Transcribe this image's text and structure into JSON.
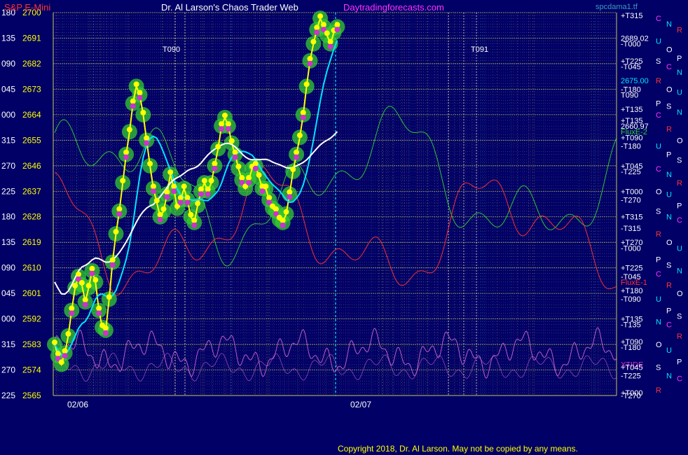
{
  "header": {
    "symbol": "S&P E-Mini",
    "title": "Dr. Al Larson's Chaos Trader Web",
    "site": "Daytradingforecasts.com",
    "filename": "spcdama1.tf"
  },
  "footer": {
    "copyright": "Copyright 2018, Dr. Al Larson. May not be copied by any means."
  },
  "colors": {
    "background": "#000066",
    "price_label": "#ffff00",
    "angle_label": "#ffffff",
    "symbol": "#ff3333",
    "title": "#ffffff",
    "site": "#ff33ff",
    "grid_yellow": "#c8c860",
    "grid_purple": "#8a3aa0",
    "grid_cyan": "#3a9ac0",
    "price_line": "#ffff00",
    "ma_white": "#ffffff",
    "ma_cyan": "#00e5ff",
    "halo": "#33cc33",
    "dot_yellow": "#ffff00",
    "dot_magenta": "#cc33cc",
    "flux_red": "#ff3333",
    "flux_green": "#33cc33",
    "flux_magenta": "#cc66cc"
  },
  "chart_data": {
    "type": "line",
    "title": "S&P E-Mini",
    "y_axis": {
      "range": [
        2565,
        2700
      ],
      "ticks": [
        2700,
        2691,
        2682,
        2673,
        2664,
        2655,
        2646,
        2637,
        2628,
        2619,
        2610,
        2601,
        2592,
        2583,
        2574,
        2565
      ],
      "angle_labels": [
        "180",
        "135",
        "090",
        "045",
        "000",
        "315",
        "270",
        "225",
        "180",
        "135",
        "090",
        "045",
        "000",
        "315",
        "270",
        "225"
      ]
    },
    "x_axis": {
      "date_labels": [
        "02/06",
        "02/07"
      ]
    },
    "session_labels": [
      "T090",
      "T091"
    ],
    "price_series": {
      "name": "S&P E-Mini",
      "points": [
        [
          0,
          2583
        ],
        [
          2,
          2579
        ],
        [
          4,
          2576
        ],
        [
          6,
          2580
        ],
        [
          8,
          2586
        ],
        [
          10,
          2595
        ],
        [
          12,
          2603
        ],
        [
          14,
          2607
        ],
        [
          16,
          2604
        ],
        [
          18,
          2598
        ],
        [
          20,
          2603
        ],
        [
          22,
          2609
        ],
        [
          24,
          2605
        ],
        [
          26,
          2595
        ],
        [
          28,
          2589
        ],
        [
          30,
          2588
        ],
        [
          32,
          2599
        ],
        [
          34,
          2612
        ],
        [
          36,
          2622
        ],
        [
          38,
          2630
        ],
        [
          40,
          2640
        ],
        [
          42,
          2650
        ],
        [
          44,
          2658
        ],
        [
          46,
          2668
        ],
        [
          48,
          2674
        ],
        [
          50,
          2671
        ],
        [
          52,
          2664
        ],
        [
          54,
          2655
        ],
        [
          56,
          2646
        ],
        [
          58,
          2638
        ],
        [
          60,
          2633
        ],
        [
          62,
          2628
        ],
        [
          64,
          2630
        ],
        [
          66,
          2636
        ],
        [
          68,
          2643
        ],
        [
          70,
          2638
        ],
        [
          72,
          2631
        ],
        [
          74,
          2634
        ],
        [
          76,
          2638
        ],
        [
          78,
          2634
        ],
        [
          80,
          2628
        ],
        [
          82,
          2626
        ],
        [
          84,
          2632
        ],
        [
          86,
          2637
        ],
        [
          88,
          2640
        ],
        [
          90,
          2637
        ],
        [
          92,
          2640
        ],
        [
          94,
          2646
        ],
        [
          96,
          2652
        ],
        [
          98,
          2660
        ],
        [
          100,
          2663
        ],
        [
          102,
          2660
        ],
        [
          104,
          2654
        ],
        [
          106,
          2650
        ],
        [
          108,
          2645
        ],
        [
          110,
          2641
        ],
        [
          112,
          2638
        ],
        [
          114,
          2641
        ],
        [
          116,
          2645
        ],
        [
          118,
          2646
        ],
        [
          120,
          2642
        ],
        [
          122,
          2638
        ],
        [
          124,
          2638
        ],
        [
          126,
          2634
        ],
        [
          128,
          2631
        ],
        [
          130,
          2630
        ],
        [
          132,
          2627
        ],
        [
          134,
          2626
        ],
        [
          136,
          2629
        ],
        [
          138,
          2636
        ],
        [
          140,
          2644
        ],
        [
          142,
          2650
        ],
        [
          144,
          2656
        ],
        [
          146,
          2664
        ],
        [
          148,
          2674
        ],
        [
          150,
          2683
        ],
        [
          152,
          2689
        ],
        [
          154,
          2694
        ],
        [
          156,
          2698
        ],
        [
          158,
          2695
        ],
        [
          160,
          2692
        ],
        [
          162,
          2689
        ],
        [
          164,
          2693
        ],
        [
          166,
          2695
        ]
      ]
    },
    "flux_lines": [
      {
        "name": "flux-1",
        "label": "Flux E-1"
      },
      {
        "name": "flux-2",
        "label": "Flux E-2"
      },
      {
        "name": "xtide",
        "label": "XTIDE"
      }
    ],
    "right_labels": [
      {
        "price": 2699,
        "text": "+T315",
        "color": "#ffffff"
      },
      {
        "price": 2691,
        "text": "2689.02",
        "color": "#ffffff"
      },
      {
        "price": 2689,
        "text": "-T000",
        "color": "#ffffff"
      },
      {
        "price": 2683,
        "text": "+T225",
        "color": "#ffffff"
      },
      {
        "price": 2681,
        "text": "-T045",
        "color": "#ffffff"
      },
      {
        "price": 2676,
        "text": "2675.00",
        "color": "#00e5ff"
      },
      {
        "price": 2673,
        "text": "-T180",
        "color": "#ffffff"
      },
      {
        "price": 2671,
        "text": "T090",
        "color": "#ffffff"
      },
      {
        "price": 2666,
        "text": "+T135",
        "color": "#ffffff"
      },
      {
        "price": 2662,
        "text": "+T135",
        "color": "#ffffff"
      },
      {
        "price": 2660,
        "text": "2660.97",
        "color": "#ffffff"
      },
      {
        "price": 2658,
        "text": "FluxE-2",
        "color": "#33cc33"
      },
      {
        "price": 2656,
        "text": "+T090",
        "color": "#ffffff"
      },
      {
        "price": 2653,
        "text": "-T180",
        "color": "#ffffff"
      },
      {
        "price": 2646,
        "text": "+T045",
        "color": "#ffffff"
      },
      {
        "price": 2644,
        "text": "-T225",
        "color": "#ffffff"
      },
      {
        "price": 2637,
        "text": "+T000",
        "color": "#ffffff"
      },
      {
        "price": 2634,
        "text": "-T270",
        "color": "#ffffff"
      },
      {
        "price": 2628,
        "text": "+T315",
        "color": "#ffffff"
      },
      {
        "price": 2624,
        "text": "-T315",
        "color": "#ffffff"
      },
      {
        "price": 2619,
        "text": "+T270",
        "color": "#ffffff"
      },
      {
        "price": 2617,
        "text": "-T000",
        "color": "#ffffff"
      },
      {
        "price": 2610,
        "text": "+T225",
        "color": "#ffffff"
      },
      {
        "price": 2607,
        "text": "-T045",
        "color": "#ffffff"
      },
      {
        "price": 2605,
        "text": "FluxE-1",
        "color": "#ff3333"
      },
      {
        "price": 2602,
        "text": "+T180",
        "color": "#ffffff"
      },
      {
        "price": 2599,
        "text": "-T090",
        "color": "#ffffff"
      },
      {
        "price": 2592,
        "text": "+T135",
        "color": "#ffffff"
      },
      {
        "price": 2590,
        "text": "-T135",
        "color": "#ffffff"
      },
      {
        "price": 2584,
        "text": "+T090",
        "color": "#ffffff"
      },
      {
        "price": 2582,
        "text": "-T180",
        "color": "#ffffff"
      },
      {
        "price": 2576,
        "text": "XTIDE",
        "color": "#cc33cc"
      },
      {
        "price": 2575,
        "text": "+T045",
        "color": "#ffffff"
      },
      {
        "price": 2572,
        "text": "-T225",
        "color": "#ffffff"
      },
      {
        "price": 2566,
        "text": "+T000",
        "color": "#ffffff"
      },
      {
        "price": 2565,
        "text": "-T270",
        "color": "#ffffff"
      }
    ],
    "planet_column": [
      {
        "price": 2698,
        "text": "C",
        "color": "#ff33ff"
      },
      {
        "price": 2696,
        "text": "N",
        "color": "#00e5ff"
      },
      {
        "price": 2694,
        "text": "R",
        "color": "#ff3333"
      },
      {
        "price": 2690,
        "text": "U",
        "color": "#00e5ff"
      },
      {
        "price": 2687,
        "text": "O",
        "color": "#ffffff"
      },
      {
        "price": 2684,
        "text": "P",
        "color": "#ffffff"
      },
      {
        "price": 2683,
        "text": "S",
        "color": "#ffffff"
      },
      {
        "price": 2681,
        "text": "C",
        "color": "#ff33ff"
      },
      {
        "price": 2679,
        "text": "N",
        "color": "#00e5ff"
      },
      {
        "price": 2676,
        "text": "R",
        "color": "#ff3333"
      },
      {
        "price": 2673,
        "text": "O",
        "color": "#ffffff"
      },
      {
        "price": 2672,
        "text": "U",
        "color": "#00e5ff"
      },
      {
        "price": 2668,
        "text": "P",
        "color": "#ffffff"
      },
      {
        "price": 2667,
        "text": "S",
        "color": "#ffffff"
      },
      {
        "price": 2665,
        "text": "N",
        "color": "#00e5ff"
      },
      {
        "price": 2664,
        "text": "C",
        "color": "#ff33ff"
      },
      {
        "price": 2659,
        "text": "R",
        "color": "#ff3333"
      },
      {
        "price": 2655,
        "text": "O",
        "color": "#ffffff"
      },
      {
        "price": 2653,
        "text": "U",
        "color": "#00e5ff"
      },
      {
        "price": 2650,
        "text": "P",
        "color": "#ffffff"
      },
      {
        "price": 2648,
        "text": "S",
        "color": "#ffffff"
      },
      {
        "price": 2645,
        "text": "C",
        "color": "#ff33ff"
      },
      {
        "price": 2643,
        "text": "N",
        "color": "#00e5ff"
      },
      {
        "price": 2640,
        "text": "R",
        "color": "#ff3333"
      },
      {
        "price": 2637,
        "text": "O",
        "color": "#ffffff"
      },
      {
        "price": 2636,
        "text": "U",
        "color": "#00e5ff"
      },
      {
        "price": 2632,
        "text": "P",
        "color": "#ffffff"
      },
      {
        "price": 2630,
        "text": "S",
        "color": "#ffffff"
      },
      {
        "price": 2628,
        "text": "N",
        "color": "#00e5ff"
      },
      {
        "price": 2627,
        "text": "C",
        "color": "#ff33ff"
      },
      {
        "price": 2622,
        "text": "R",
        "color": "#ff3333"
      },
      {
        "price": 2619,
        "text": "O",
        "color": "#ffffff"
      },
      {
        "price": 2617,
        "text": "U",
        "color": "#00e5ff"
      },
      {
        "price": 2613,
        "text": "P",
        "color": "#ffffff"
      },
      {
        "price": 2611,
        "text": "S",
        "color": "#ffffff"
      },
      {
        "price": 2609,
        "text": "N",
        "color": "#00e5ff"
      },
      {
        "price": 2608,
        "text": "C",
        "color": "#ff33ff"
      },
      {
        "price": 2604,
        "text": "R",
        "color": "#ff3333"
      },
      {
        "price": 2601,
        "text": "O",
        "color": "#ffffff"
      },
      {
        "price": 2599,
        "text": "U",
        "color": "#00e5ff"
      },
      {
        "price": 2595,
        "text": "P",
        "color": "#ffffff"
      },
      {
        "price": 2593,
        "text": "S",
        "color": "#ffffff"
      },
      {
        "price": 2591,
        "text": "N",
        "color": "#00e5ff"
      },
      {
        "price": 2590,
        "text": "C",
        "color": "#ff33ff"
      },
      {
        "price": 2586,
        "text": "R",
        "color": "#ff3333"
      },
      {
        "price": 2583,
        "text": "O",
        "color": "#ffffff"
      },
      {
        "price": 2581,
        "text": "U",
        "color": "#00e5ff"
      },
      {
        "price": 2577,
        "text": "P",
        "color": "#ffffff"
      },
      {
        "price": 2575,
        "text": "S",
        "color": "#ffffff"
      },
      {
        "price": 2572,
        "text": "N",
        "color": "#00e5ff"
      },
      {
        "price": 2571,
        "text": "C",
        "color": "#ff33ff"
      },
      {
        "price": 2567,
        "text": "R",
        "color": "#ff3333"
      }
    ],
    "grid": true
  }
}
